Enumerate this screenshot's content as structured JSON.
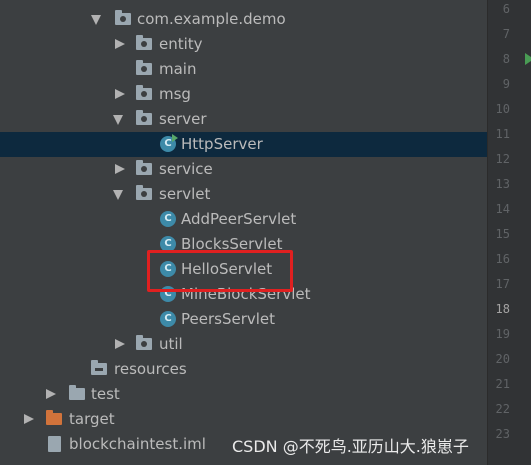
{
  "tree": {
    "package_demo": "com.example.demo",
    "entity": "entity",
    "main": "main",
    "msg": "msg",
    "server": "server",
    "http_server": "HttpServer",
    "service": "service",
    "servlet": "servlet",
    "add_peer_servlet": "AddPeerServlet",
    "blocks_servlet": "BlocksServlet",
    "hello_servlet": "HelloServlet",
    "mine_block_servlet": "MineBlockServlet",
    "peers_servlet": "PeersServlet",
    "util": "util",
    "resources": "resources",
    "test": "test",
    "target": "target",
    "iml_file": "blockchaintest.iml"
  },
  "class_icon_letter": "C",
  "gutter": {
    "line_numbers": [
      "6",
      "7",
      "8",
      "9",
      "10",
      "11",
      "12",
      "13",
      "14",
      "15",
      "16",
      "17",
      "18",
      "19",
      "20",
      "21",
      "22",
      "23"
    ],
    "current_line": "18"
  },
  "watermark": "CSDN @不死鸟.亚历山大.狼崽子",
  "colors": {
    "background": "#3c3f41",
    "selected_row": "#0d293e",
    "gutter": "#313335",
    "highlight_box": "#e02020",
    "class_icon": "#3d8aa8"
  }
}
